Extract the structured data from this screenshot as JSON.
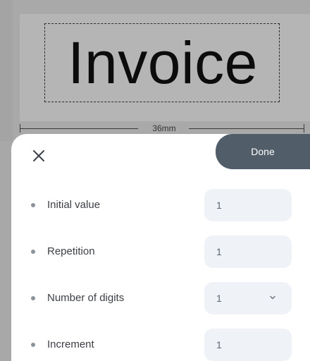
{
  "preview": {
    "label_text": "Invoice",
    "width_label": "36mm"
  },
  "toolbar": {
    "close_icon": "close-icon",
    "done_label": "Done"
  },
  "settings": {
    "rows": [
      {
        "label": "Initial value",
        "value": "1",
        "type": "input"
      },
      {
        "label": "Repetition",
        "value": "1",
        "type": "input"
      },
      {
        "label": "Number of digits",
        "value": "1",
        "type": "select"
      },
      {
        "label": "Increment",
        "value": "1",
        "type": "input"
      }
    ]
  },
  "colors": {
    "done_button": "#515d68",
    "field_background": "#eff2f6",
    "canvas_background": "#b5b5b5"
  }
}
